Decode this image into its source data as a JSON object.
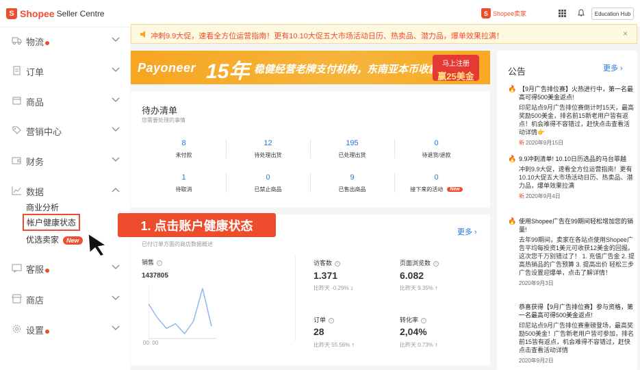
{
  "topbar": {
    "brand_name": "Shopee",
    "brand_suffix": "Seller Centre",
    "right_brand": "Shopee卖家",
    "education_hub": "Education Hub"
  },
  "sidebar": {
    "menu": [
      {
        "label": "物流"
      },
      {
        "label": "订单"
      },
      {
        "label": "商品"
      },
      {
        "label": "营销中心"
      },
      {
        "label": "财务"
      },
      {
        "label": "数据"
      },
      {
        "label": "客服"
      },
      {
        "label": "商店"
      },
      {
        "label": "设置"
      }
    ],
    "data_sub": [
      "商业分析",
      "帐户健康状态",
      "优选卖家"
    ],
    "new_badge": "New"
  },
  "callout": "1. 点击账户健康状态",
  "notice": {
    "text": "冲刺9.9大促，速看全方位运营指南！更有10.10大促五大市场活动日历、热卖品、潜力品，爆单效果拉满！",
    "close": "×"
  },
  "banner": {
    "brand": "Payoneer",
    "years": "15年",
    "slogan": "稳健经营老牌支付机构，东南亚本币收款0汇损！",
    "register": "马上注册",
    "reward": "赢25美金"
  },
  "todo": {
    "title": "待办清单",
    "subtitle": "您需要处理的事情",
    "stats": [
      {
        "value": "8",
        "label": "未付款"
      },
      {
        "value": "12",
        "label": "待处理出货"
      },
      {
        "value": "195",
        "label": "已处理出货"
      },
      {
        "value": "0",
        "label": "待退货/退款"
      },
      {
        "value": "1",
        "label": "待取消"
      },
      {
        "value": "0",
        "label": "已禁止商品"
      },
      {
        "value": "9",
        "label": "已售出商品"
      },
      {
        "value": "0",
        "label": "接下来的活动"
      }
    ],
    "new_badge": "New"
  },
  "business": {
    "more": "更多",
    "desc": "已付订单方面的商店数据概述",
    "sales_label": "销售",
    "sales_value": "1437805",
    "time_label": "00: 00",
    "visitors_label": "访客数",
    "visitors_value": "1.371",
    "visitors_cmp": "比昨天 -0.29%",
    "pageviews_label": "页面浏览数",
    "pageviews_value": "6.082",
    "pageviews_cmp": "比昨天 9.35%",
    "orders_label": "订单",
    "orders_value": "28",
    "orders_cmp": "比昨天 55.56%",
    "conversion_label": "转化率",
    "conversion_value": "2,04%",
    "conversion_cmp": "比昨天 0.73%",
    "sparkline": [
      0.35,
      0.62,
      0.82,
      0.73,
      0.92,
      0.68,
      0.05,
      0.78
    ]
  },
  "announcements": {
    "title": "公告",
    "more": "更多",
    "new_tag": "新",
    "items": [
      {
        "title": "【9月广告排位赛】火热进行中，第一名最高可得500美金返点!",
        "body": "印尼站点9月广告排位赛倒计时15天，最高奖励500美金，排名前15新老用户皆有返点！机会难得不容错过，赶快点击查看活动详情👉",
        "date": "2020年9月15日"
      },
      {
        "title": "9.9冲刺清单! 10.10日历选品的马台菲越",
        "body": "冲刺9.9大促，速看全方位运营指南！更有10.10大促五大市场活动日历、热卖品、潜力品，爆单效果拉满",
        "date": "2020年9月4日"
      },
      {
        "title": "使用Shopee广告在99期间轻松增加您的销量!",
        "body": "去年99期间，卖家在各站点使用Shopee广告平均每投资1美元可收获12美金的回报。这次您千万别错过了！ 1. 充值广告金 2. 提高热销品的广告预算 3. 提高出价 轻松三步广告设置迎爆单，点击了解详情！",
        "date": "2020年9月3日"
      },
      {
        "title": "恭喜获得【9月广告排位赛】参与资格，第一名最高可得500美金返点!",
        "body": "印尼站点9月广告排位赛重磅登场，最高奖励500美金！广告新老用户皆可参加，排名前15皆有返点，机会难得不容错过，赶快点击查看活动详情",
        "date": "2020年9月2日"
      }
    ]
  }
}
